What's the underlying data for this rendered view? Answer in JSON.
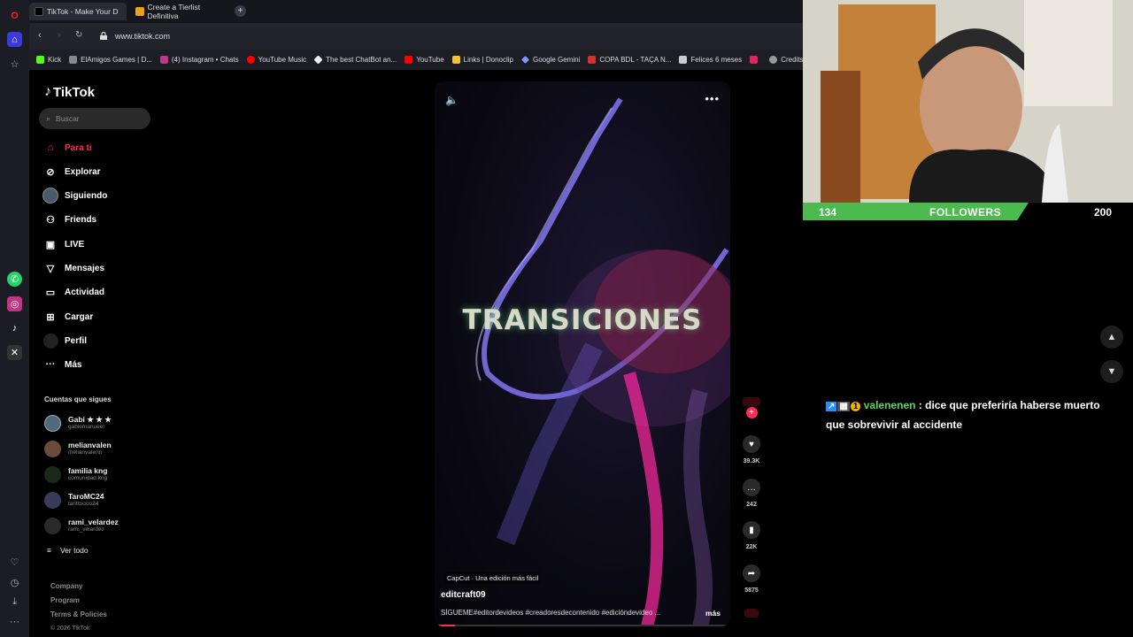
{
  "browser": {
    "tabs": [
      {
        "label": "TikTok - Make Your D"
      },
      {
        "label": "Create a Tierlist Definitiva"
      }
    ],
    "new_tab": "+",
    "url": "www.tiktok.com",
    "bookmarks": [
      "Kick",
      "ElAmigos Games | D...",
      "(4) Instagram • Chats",
      "YouTube Music",
      "The best ChatBot an...",
      "YouTube",
      "Links | Donoclip",
      "Google Gemini",
      "COPA BDL - TAÇA N...",
      "Felices 6 meses",
      "Credits - Ad"
    ]
  },
  "tiktok": {
    "logo": "TikTok",
    "search_placeholder": "Buscar",
    "nav": [
      "Para ti",
      "Explorar",
      "Siguiendo",
      "Friends",
      "LIVE",
      "Mensajes",
      "Actividad",
      "Cargar",
      "Perfil",
      "Más"
    ],
    "following_title": "Cuentas que sigues",
    "accounts": [
      {
        "name": "Gabi ★ ★ ★",
        "handle": "gabiemanueel"
      },
      {
        "name": "melianvalen",
        "handle": "melianvalenn"
      },
      {
        "name": "familia kng",
        "handle": "comunidad.kng"
      },
      {
        "name": "TaroMC24",
        "handle": "tarittoooo24"
      },
      {
        "name": "rami_velardez",
        "handle": "rami_velardez"
      }
    ],
    "see_all": "Ver todo",
    "footer": [
      "Company",
      "Program",
      "Terms & Policies",
      "© 2026 TikTok"
    ]
  },
  "video": {
    "overlay_title": "TRANSICIONES",
    "capcut": "CapCut · Una edición más fácil",
    "author": "editcraft09",
    "caption": "SÍGUEME#editordevideos #creadoresdecontenido #edicióndevideo ...",
    "more": "más",
    "progress": 0.07,
    "likes": "39.3K",
    "comments": "242",
    "saves": "22K",
    "shares": "5875"
  },
  "stream": {
    "followers_current": "134",
    "followers_label": "FOLLOWERS",
    "followers_goal": "200",
    "chat_user": "valenenen",
    "chat_message": ": dice que preferiría haberse muerto que sobrevivir al accidente"
  },
  "colors": {
    "tiktok_red": "#fe2c55",
    "follower_green": "#4cbb4f",
    "chat_user": "#59d65f"
  }
}
